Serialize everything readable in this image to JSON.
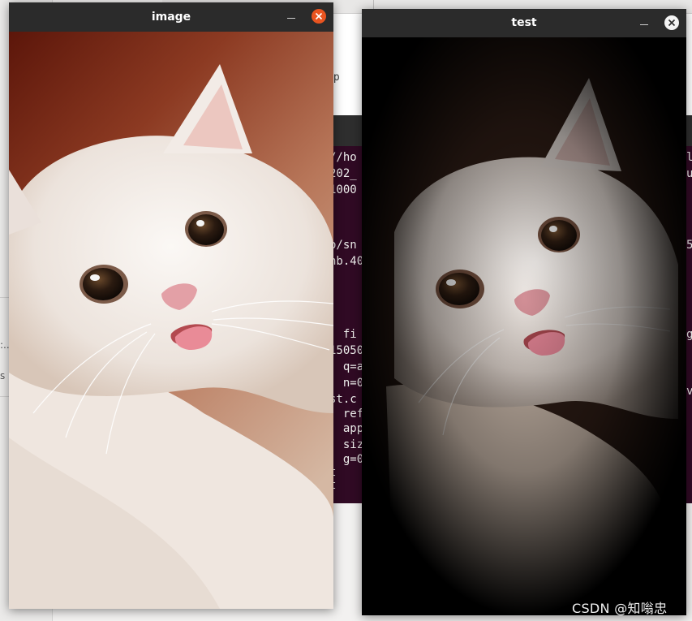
{
  "windows": {
    "image": {
      "title": "image",
      "close_color": "#e95420",
      "background_gradient": [
        "#5a1509",
        "#8a2e17",
        "#b56a48",
        "#d9b79d"
      ]
    },
    "test": {
      "title": "test",
      "close_color": "#f4f4f4"
    }
  },
  "background": {
    "top_snippet": "op",
    "terminal_lines": [
      "//ho",
      "202_",
      "1000",
      "",
      "",
      "o/sn",
      "nb.40",
      "",
      "",
      "  fi",
      "15050",
      "  q=a",
      "  n=0",
      "st.c",
      "  ref",
      "  app",
      "  siz",
      "  g=0",
      "t",
      "t"
    ],
    "terminal_right_chars": [
      "l",
      "u",
      "",
      "",
      "5",
      "",
      "",
      "",
      "g",
      "",
      "",
      "v"
    ],
    "side_labels": [
      ":..",
      "s"
    ]
  },
  "watermark": "CSDN @知嗡忠",
  "icons": {
    "minimize": "minimize-icon",
    "close": "close-icon"
  }
}
